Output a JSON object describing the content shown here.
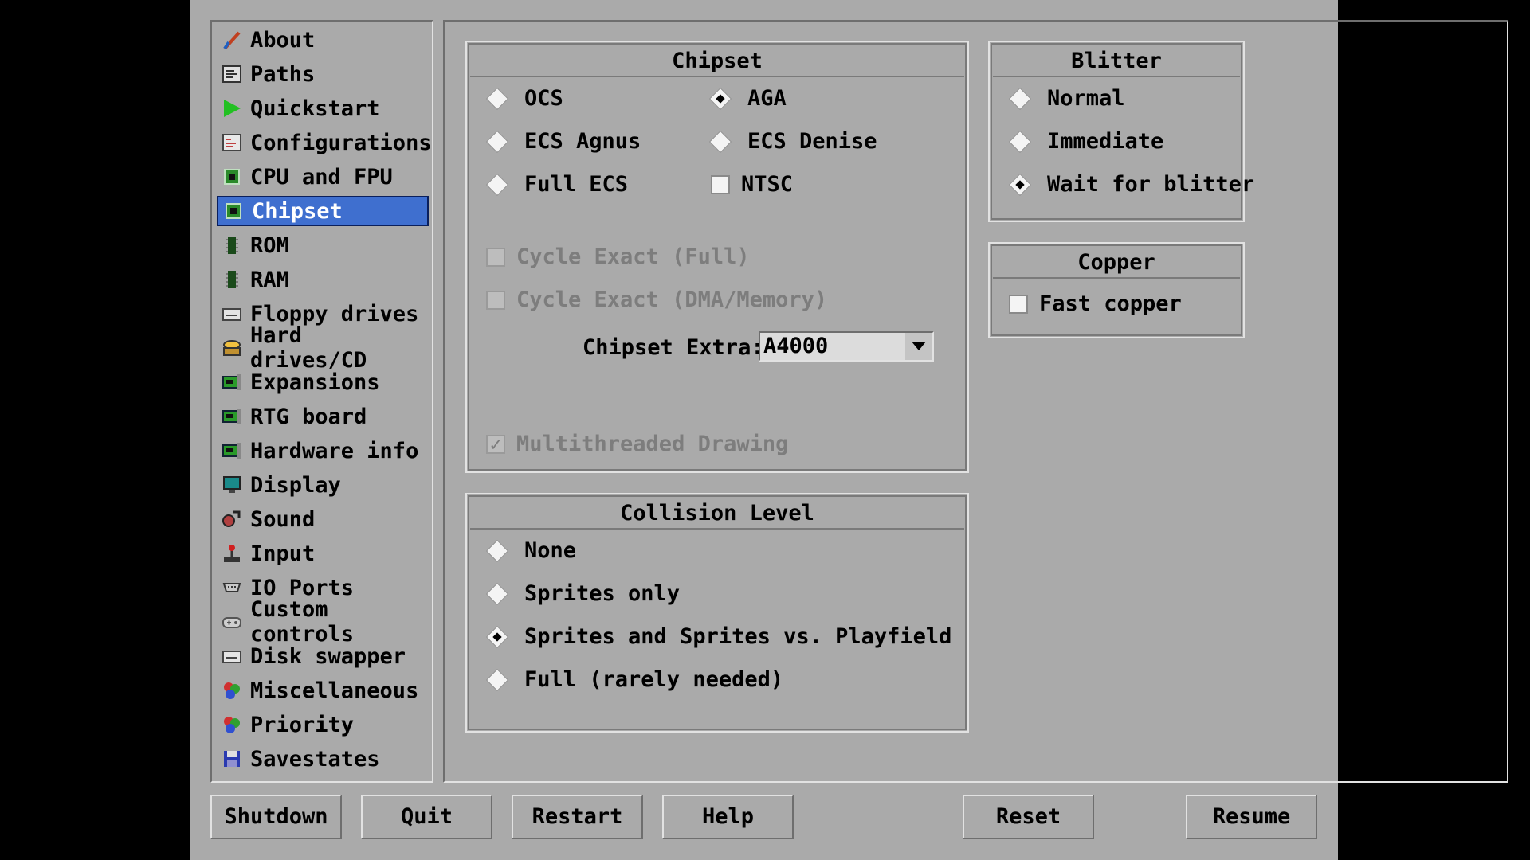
{
  "sidebar": {
    "items": [
      {
        "label": "About",
        "icon": "about-icon"
      },
      {
        "label": "Paths",
        "icon": "paths-icon"
      },
      {
        "label": "Quickstart",
        "icon": "quickstart-icon"
      },
      {
        "label": "Configurations",
        "icon": "configurations-icon"
      },
      {
        "label": "CPU and FPU",
        "icon": "cpu-icon"
      },
      {
        "label": "Chipset",
        "icon": "chipset-icon"
      },
      {
        "label": "ROM",
        "icon": "rom-icon"
      },
      {
        "label": "RAM",
        "icon": "ram-icon"
      },
      {
        "label": "Floppy drives",
        "icon": "floppy-icon"
      },
      {
        "label": "Hard drives/CD",
        "icon": "hard-drive-icon"
      },
      {
        "label": "Expansions",
        "icon": "expansion-card-icon"
      },
      {
        "label": "RTG board",
        "icon": "rtg-board-icon"
      },
      {
        "label": "Hardware info",
        "icon": "hardware-info-icon"
      },
      {
        "label": "Display",
        "icon": "display-icon"
      },
      {
        "label": "Sound",
        "icon": "sound-icon"
      },
      {
        "label": "Input",
        "icon": "joystick-icon"
      },
      {
        "label": "IO Ports",
        "icon": "io-ports-icon"
      },
      {
        "label": "Custom controls",
        "icon": "gamepad-icon"
      },
      {
        "label": "Disk swapper",
        "icon": "disk-swapper-icon"
      },
      {
        "label": "Miscellaneous",
        "icon": "miscellaneous-icon"
      },
      {
        "label": "Priority",
        "icon": "priority-icon"
      },
      {
        "label": "Savestates",
        "icon": "save-disk-icon"
      }
    ],
    "active": "Chipset"
  },
  "chipset": {
    "title": "Chipset",
    "ocs": "OCS",
    "aga": "AGA",
    "ecs_agnus": "ECS Agnus",
    "ecs_denise": "ECS Denise",
    "full_ecs": "Full ECS",
    "ntsc": "NTSC",
    "selected": "AGA",
    "ntsc_checked": false,
    "cycle_exact_full": "Cycle Exact (Full)",
    "cycle_exact_dma": "Cycle Exact (DMA/Memory)",
    "extra_label": "Chipset Extra:",
    "extra_value": "A4000",
    "multithreaded": "Multithreaded Drawing",
    "multithreaded_checked": true
  },
  "blitter": {
    "title": "Blitter",
    "normal": "Normal",
    "immediate": "Immediate",
    "wait": "Wait for blitter",
    "selected": "Wait for blitter"
  },
  "copper": {
    "title": "Copper",
    "fast": "Fast copper",
    "fast_checked": false
  },
  "collision": {
    "title": "Collision Level",
    "none": "None",
    "sprites": "Sprites only",
    "sprites_playfield": "Sprites and Sprites vs. Playfield",
    "full": "Full (rarely needed)",
    "selected": "Sprites and Sprites vs. Playfield"
  },
  "buttons": {
    "shutdown": "Shutdown",
    "quit": "Quit",
    "restart": "Restart",
    "help": "Help",
    "reset": "Reset",
    "resume": "Resume"
  },
  "colors": {
    "background": "#aaaaaa",
    "highlight": "#3f6fcf",
    "letterbox": "#000000"
  },
  "check_glyph": "✓"
}
